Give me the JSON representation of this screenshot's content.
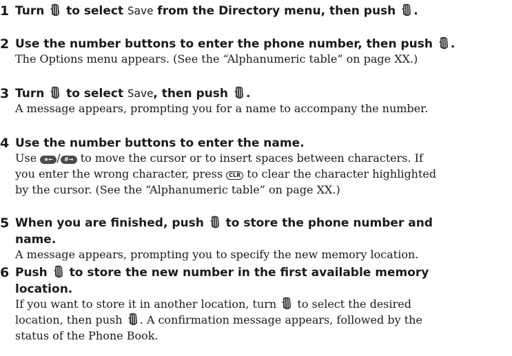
{
  "steps": [
    {
      "number": "1",
      "heading_a": "Turn",
      "heading_b": "to select",
      "lcd": "Save",
      "heading_c": "from the Directory menu, then push",
      "heading_d": "."
    },
    {
      "number": "2",
      "heading_a": "Use the number buttons to enter the phone number, then push",
      "heading_b": ".",
      "body": "The Options menu appears. (See the “Alphanumeric table” on page XX.)"
    },
    {
      "number": "3",
      "heading_a": "Turn",
      "heading_b": "to select",
      "lcd": "Save",
      "heading_c": ", then push",
      "heading_d": ".",
      "body": "A message appears, prompting you for a name to accompany the number."
    },
    {
      "number": "4",
      "heading": "Use the number buttons to enter the name.",
      "body_a": "Use",
      "body_b": "to move the cursor or to insert spaces between characters. If",
      "body_c": "you enter the wrong character, press",
      "body_d": "to clear the character highlighted",
      "body_e": "by the cursor. (See the “Alphanumeric table” on page XX.)"
    },
    {
      "number": "5",
      "heading_a": "When you are finished, push",
      "heading_b": "to store the phone number and",
      "heading_c": "name.",
      "body": "A message appears, prompting you to specify the new memory location."
    },
    {
      "number": "6",
      "heading_a": "Push",
      "heading_b": "to store the new number in the first available memory",
      "heading_c": "location.",
      "body_a": "If you want to store it in another location, turn",
      "body_b": "to select the desired",
      "body_c": "location, then push",
      "body_d": ". A confirmation message appears, followed by the",
      "body_e": "status of the Phone Book."
    }
  ],
  "icons": {
    "jog_dial": "jog-dial-icon",
    "star_key": "star-key-icon",
    "hash_key": "hash-key-icon",
    "clr_key": "clr-key-icon"
  },
  "keys": {
    "star": "∗←",
    "hash": "#→",
    "clr": "CLR",
    "separator": "/"
  },
  "colors": {
    "text": "#1a1a1a",
    "key_fill": "#4a4a4a"
  }
}
